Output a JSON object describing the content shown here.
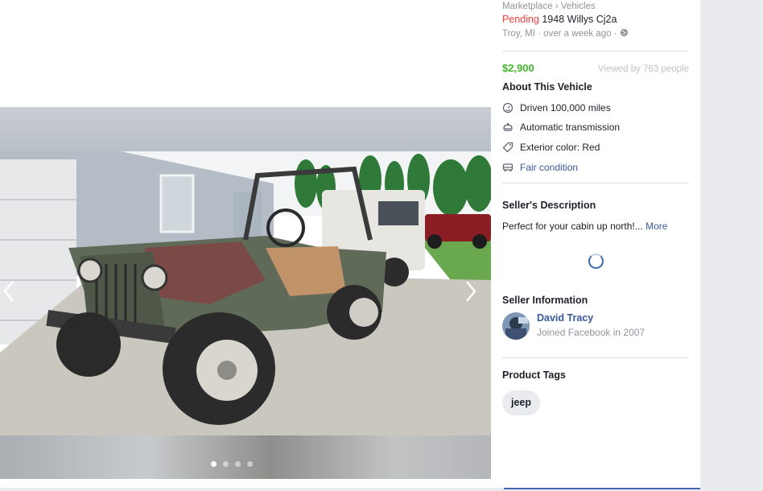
{
  "breadcrumb": {
    "root": "Marketplace",
    "sep": "›",
    "section": "Vehicles"
  },
  "listing": {
    "status": "Pending",
    "title": "1948 Willys Cj2a",
    "location_time": "Troy, MI · over a week ago ·",
    "price": "$2,900",
    "viewed": "Viewed by 763 people"
  },
  "about": {
    "heading": "About This Vehicle",
    "items": [
      {
        "icon": "speedometer-icon",
        "label": "Driven 100,000 miles"
      },
      {
        "icon": "steering-icon",
        "label": "Automatic transmission"
      },
      {
        "icon": "tag-icon",
        "label": "Exterior color: Red"
      },
      {
        "icon": "car-icon",
        "label": "Fair condition"
      }
    ]
  },
  "description": {
    "heading": "Seller's Description",
    "text": "Perfect for your cabin up north!...",
    "more": "More"
  },
  "seller": {
    "heading": "Seller Information",
    "name": "David Tracy",
    "joined": "Joined Facebook in 2007"
  },
  "tags": {
    "heading": "Product Tags",
    "items": [
      "jeep"
    ]
  },
  "gallery": {
    "photo_count": 4,
    "active_index": 0
  },
  "colors": {
    "pending": "#fa3e3e",
    "price": "#42b72a",
    "link": "#385898",
    "accent": "#4267b2"
  }
}
